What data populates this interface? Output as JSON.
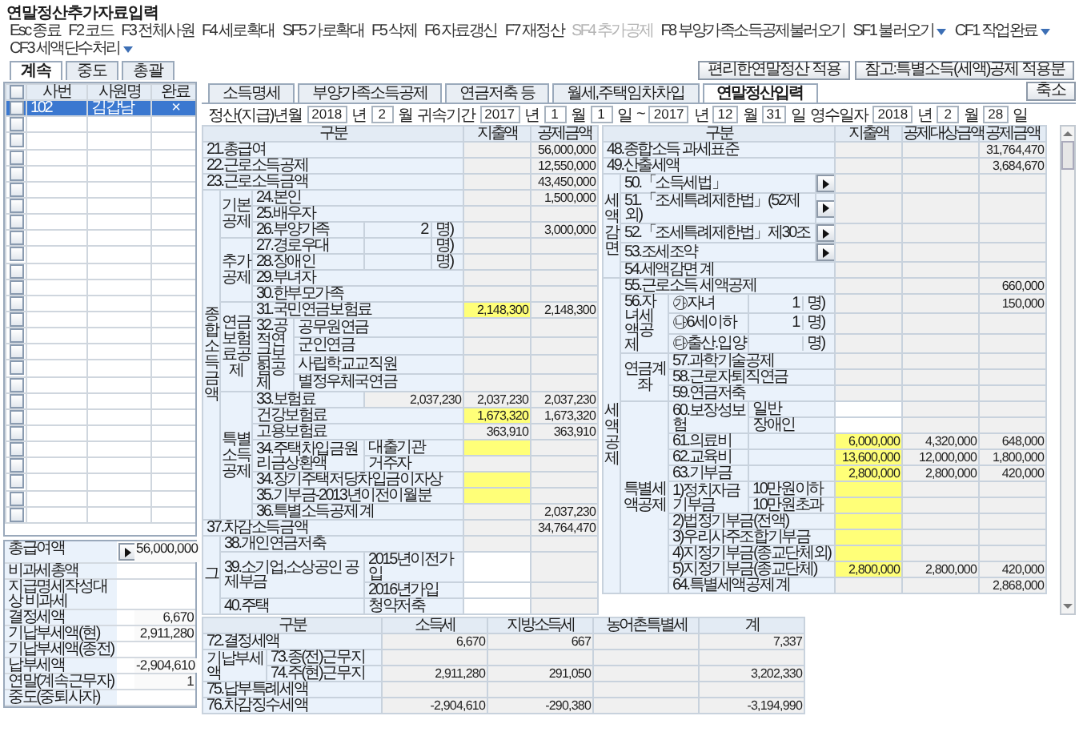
{
  "window": {
    "title": "연말정산추가자료입력"
  },
  "toolbar": [
    {
      "text": "Esc 종료",
      "disabled": false,
      "dropdown": false
    },
    {
      "text": "F2 코드",
      "disabled": false,
      "dropdown": false
    },
    {
      "text": "F3 전체사원",
      "disabled": false,
      "dropdown": false
    },
    {
      "text": "F4 세로확대",
      "disabled": false,
      "dropdown": false
    },
    {
      "text": "SF5 가로확대",
      "disabled": false,
      "dropdown": false
    },
    {
      "text": "F5 삭제",
      "disabled": false,
      "dropdown": false
    },
    {
      "text": "F6 자료갱신",
      "disabled": false,
      "dropdown": false
    },
    {
      "text": "F7 재정산",
      "disabled": false,
      "dropdown": false
    },
    {
      "text": "SF4 추가공제",
      "disabled": true,
      "dropdown": false
    },
    {
      "text": "F8 부양가족소득공제불러오기",
      "disabled": false,
      "dropdown": false
    },
    {
      "text": "SF1 불러오기",
      "disabled": false,
      "dropdown": true
    },
    {
      "text": "CF1 작업완료",
      "disabled": false,
      "dropdown": true
    },
    {
      "text": "CF3 세액단수처리",
      "disabled": false,
      "dropdown": true
    }
  ],
  "tabs": [
    {
      "label": "계속",
      "selected": true
    },
    {
      "label": "중도",
      "selected": false
    },
    {
      "label": "총괄",
      "selected": false
    }
  ],
  "actions": [
    "편리한연말정산 적용",
    "참고:특별소득(세액)공제 적용분"
  ],
  "employees": {
    "all_checked": false,
    "columns": [
      "사번",
      "사원명",
      "완료"
    ],
    "rows": [
      {
        "checked": false,
        "selected": true,
        "code": "102",
        "name": "김갑남",
        "done": "×"
      },
      {
        "checked": false,
        "selected": false
      },
      {
        "checked": false,
        "selected": false
      },
      {
        "checked": false,
        "selected": false
      },
      {
        "checked": false,
        "selected": false
      },
      {
        "checked": false,
        "selected": false
      },
      {
        "checked": false,
        "selected": false
      },
      {
        "checked": false,
        "selected": false
      },
      {
        "checked": false,
        "selected": false
      },
      {
        "checked": false,
        "selected": false
      },
      {
        "checked": false,
        "selected": false
      },
      {
        "checked": false,
        "selected": false
      },
      {
        "checked": false,
        "selected": false
      },
      {
        "checked": false,
        "selected": false
      },
      {
        "checked": false,
        "selected": false
      },
      {
        "checked": false,
        "selected": false
      },
      {
        "checked": false,
        "selected": false
      },
      {
        "checked": false,
        "selected": false
      },
      {
        "checked": false,
        "selected": false
      },
      {
        "checked": false,
        "selected": false
      },
      {
        "checked": false,
        "selected": false
      },
      {
        "checked": false,
        "selected": false
      },
      {
        "checked": false,
        "selected": false
      },
      {
        "checked": false,
        "selected": false
      },
      {
        "checked": false,
        "selected": false
      },
      {
        "checked": false,
        "selected": false
      }
    ]
  },
  "summary": [
    {
      "label": "총급여액",
      "kind": "arrow",
      "value": "56,000,000"
    },
    {
      "label": "비과세총액",
      "kind": "plain"
    },
    {
      "label": "지급명세작성대상 비과세",
      "kind": "plain"
    },
    {
      "label": "결정세액",
      "kind": "plain",
      "value": "6,670"
    },
    {
      "label": "기납부세액(현)",
      "kind": "plain",
      "value": "2,911,280"
    },
    {
      "label": "기납부세액(종전)",
      "kind": "plain"
    },
    {
      "label": "납부세액",
      "kind": "plain",
      "value": "-2,904,610"
    },
    {
      "label": "연말(계속근무자)",
      "kind": "plain",
      "value": "1"
    },
    {
      "label": "중도(중퇴사자)",
      "kind": "plain"
    }
  ],
  "main_tabs": [
    {
      "label": "소득명세",
      "selected": false
    },
    {
      "label": "부양가족소득공제",
      "selected": false
    },
    {
      "label": "연금저축 등",
      "selected": false
    },
    {
      "label": "월세,주택임차차입",
      "selected": false
    },
    {
      "label": "연말정산입력",
      "selected": true
    }
  ],
  "collapse_button": "축소",
  "period": [
    {
      "kind": "label",
      "text": "정산(지급)년월"
    },
    {
      "kind": "field",
      "text": "2018"
    },
    {
      "kind": "label",
      "text": "년"
    },
    {
      "kind": "field",
      "text": "2"
    },
    {
      "kind": "label",
      "text": "월"
    },
    {
      "kind": "label",
      "text": "귀속기간"
    },
    {
      "kind": "field",
      "text": "2017"
    },
    {
      "kind": "label",
      "text": "년"
    },
    {
      "kind": "field",
      "text": "1"
    },
    {
      "kind": "label",
      "text": "월"
    },
    {
      "kind": "field",
      "text": "1"
    },
    {
      "kind": "label",
      "text": "일"
    },
    {
      "kind": "label",
      "text": "~"
    },
    {
      "kind": "field",
      "text": "2017"
    },
    {
      "kind": "label",
      "text": "년"
    },
    {
      "kind": "field",
      "text": "12"
    },
    {
      "kind": "label",
      "text": "월"
    },
    {
      "kind": "field",
      "text": "31"
    },
    {
      "kind": "label",
      "text": "일"
    },
    {
      "kind": "label",
      "text": "영수일자"
    },
    {
      "kind": "field",
      "text": "2018"
    },
    {
      "kind": "label",
      "text": "년"
    },
    {
      "kind": "field",
      "text": "2"
    },
    {
      "kind": "label",
      "text": "월"
    },
    {
      "kind": "field",
      "text": "28"
    },
    {
      "kind": "label",
      "text": "일"
    }
  ],
  "income_table": {
    "rows": [
      [
        {
          "kind": "head",
          "text": "구분",
          "colspan": 5
        },
        {
          "kind": "head",
          "text": "지출액"
        },
        {
          "kind": "head",
          "text": "공제금액"
        }
      ],
      [
        {
          "kind": "label",
          "text": "21.총급여",
          "colspan": 5
        },
        {
          "kind": "num"
        },
        {
          "kind": "num",
          "text": "56,000,000"
        }
      ],
      [
        {
          "kind": "label",
          "text": "22.근로소득공제",
          "colspan": 5
        },
        {
          "kind": "num"
        },
        {
          "kind": "num",
          "text": "12,550,000"
        }
      ],
      [
        {
          "kind": "label",
          "text": "23.근로소득금액",
          "colspan": 5
        },
        {
          "kind": "num"
        },
        {
          "kind": "num",
          "text": "43,450,000"
        }
      ],
      [
        {
          "kind": "vert",
          "text": "종합소득금액",
          "rowspan": 20
        },
        {
          "kind": "vert",
          "text": "기본공제",
          "rowspan": 3
        },
        {
          "kind": "label",
          "text": "24.본인",
          "colspan": 3
        },
        {
          "kind": "num"
        },
        {
          "kind": "num",
          "text": "1,500,000"
        }
      ],
      [
        {
          "kind": "label",
          "text": "25.배우자",
          "colspan": 3
        },
        {
          "kind": "num"
        },
        {
          "kind": "num"
        }
      ],
      [
        {
          "kind": "label",
          "text": "26.부양가족",
          "colspan": 2
        },
        {
          "kind": "count",
          "count": "2",
          "unit": "명)"
        },
        {
          "kind": "num"
        },
        {
          "kind": "num",
          "text": "3,000,000"
        }
      ],
      [
        {
          "kind": "vert",
          "text": "추가공제",
          "rowspan": 4
        },
        {
          "kind": "label",
          "text": "27.경로우대",
          "colspan": 2
        },
        {
          "kind": "count",
          "unit": "명)"
        },
        {
          "kind": "num"
        },
        {
          "kind": "num"
        }
      ],
      [
        {
          "kind": "label",
          "text": "28.장애인",
          "colspan": 2
        },
        {
          "kind": "count",
          "unit": "명)"
        },
        {
          "kind": "num"
        },
        {
          "kind": "num"
        }
      ],
      [
        {
          "kind": "label",
          "text": "29.부녀자",
          "colspan": 3
        },
        {
          "kind": "num"
        },
        {
          "kind": "num"
        }
      ],
      [
        {
          "kind": "label",
          "text": "30.한부모가족",
          "colspan": 3
        },
        {
          "kind": "num"
        },
        {
          "kind": "num"
        }
      ],
      [
        {
          "kind": "vert",
          "text": "연금보험료공제",
          "rowspan": 5
        },
        {
          "kind": "label",
          "text": "31.국민연금보험료",
          "colspan": 3
        },
        {
          "kind": "input",
          "text": "2,148,300"
        },
        {
          "kind": "num",
          "text": "2,148,300"
        }
      ],
      [
        {
          "kind": "label",
          "text": "32.공적연금보험공제",
          "rowspan": 4
        },
        {
          "kind": "label",
          "text": "공무원연금",
          "colspan": 2
        },
        {
          "kind": "num"
        },
        {
          "kind": "num"
        }
      ],
      [
        {
          "kind": "label",
          "text": "군인연금",
          "colspan": 2
        },
        {
          "kind": "num"
        },
        {
          "kind": "num"
        }
      ],
      [
        {
          "kind": "label",
          "text": "사립학교교직원",
          "colspan": 2
        },
        {
          "kind": "num"
        },
        {
          "kind": "num"
        }
      ],
      [
        {
          "kind": "label",
          "text": "별정우체국연금",
          "colspan": 2
        },
        {
          "kind": "num"
        },
        {
          "kind": "num"
        }
      ],
      [
        {
          "kind": "vert",
          "text": "특별소득공제",
          "rowspan": 8
        },
        {
          "kind": "label",
          "text": "33.보험료",
          "colspan": 2
        },
        {
          "kind": "num",
          "text": "2,037,230"
        },
        {
          "kind": "num",
          "text": "2,037,230"
        },
        {
          "kind": "num",
          "text": "2,037,230"
        }
      ],
      [
        {
          "kind": "label",
          "text": "건강보험료",
          "colspan": 3
        },
        {
          "kind": "input",
          "text": "1,673,320"
        },
        {
          "kind": "num",
          "text": "1,673,320"
        }
      ],
      [
        {
          "kind": "label",
          "text": "고용보험료",
          "colspan": 3
        },
        {
          "kind": "num",
          "text": "363,910"
        },
        {
          "kind": "num",
          "text": "363,910"
        }
      ],
      [
        {
          "kind": "label",
          "text": "34.주택차입금원리금상환액",
          "colspan": 2,
          "rowspan": 2
        },
        {
          "kind": "label",
          "text": "대출기관"
        },
        {
          "kind": "input"
        },
        {
          "kind": "num"
        }
      ],
      [
        {
          "kind": "label",
          "text": "거주자"
        },
        {
          "kind": "num"
        },
        {
          "kind": "num"
        }
      ],
      [
        {
          "kind": "label",
          "text": "34.장기주택저당차입금이자상",
          "colspan": 3
        },
        {
          "kind": "input"
        },
        {
          "kind": "num"
        }
      ],
      [
        {
          "kind": "label",
          "text": "35.기부금-2013년이전이월분",
          "colspan": 3
        },
        {
          "kind": "input"
        },
        {
          "kind": "num"
        }
      ],
      [
        {
          "kind": "label",
          "text": "36.특별소득공제 계",
          "colspan": 3
        },
        {
          "kind": "num"
        },
        {
          "kind": "num",
          "text": "2,037,230"
        }
      ],
      [
        {
          "kind": "label",
          "text": "37.차감소득금액",
          "colspan": 5
        },
        {
          "kind": "num"
        },
        {
          "kind": "num",
          "text": "34,764,470"
        }
      ],
      [
        {
          "kind": "vert",
          "text": "그",
          "rowspan": 4
        },
        {
          "kind": "label",
          "text": "38.개인연금저축",
          "colspan": 4
        },
        {
          "kind": "num"
        },
        {
          "kind": "num"
        }
      ],
      [
        {
          "kind": "label",
          "text": "39.소기업,소상공인 공제부금",
          "colspan": 3,
          "rowspan": 2
        },
        {
          "kind": "label",
          "text": "2015년이전가입"
        },
        {
          "kind": "field"
        },
        {
          "kind": "num"
        }
      ],
      [
        {
          "kind": "label",
          "text": "2016년가입"
        },
        {
          "kind": "field"
        },
        {
          "kind": "num"
        }
      ],
      [
        {
          "kind": "label",
          "text": "40.주택",
          "colspan": 3
        },
        {
          "kind": "label",
          "text": "청약저축"
        },
        {
          "kind": "field"
        },
        {
          "kind": "num"
        }
      ]
    ]
  },
  "tax_table": {
    "rows": [
      [
        {
          "kind": "head",
          "text": "구분",
          "colspan": 5
        },
        {
          "kind": "head",
          "text": "지출액"
        },
        {
          "kind": "head",
          "text": "공제대상금액"
        },
        {
          "kind": "head",
          "text": "공제금액"
        }
      ],
      [
        {
          "kind": "label",
          "text": "48.종합소득 과세표준",
          "colspan": 5
        },
        {
          "kind": "num"
        },
        {
          "kind": "num"
        },
        {
          "kind": "num",
          "text": "31,764,470"
        }
      ],
      [
        {
          "kind": "label",
          "text": "49.산출세액",
          "colspan": 5
        },
        {
          "kind": "num"
        },
        {
          "kind": "num"
        },
        {
          "kind": "num",
          "text": "3,684,670"
        }
      ],
      [
        {
          "kind": "vert",
          "text": "세액감면",
          "rowspan": 5
        },
        {
          "kind": "label",
          "text": "50.「소득세법」",
          "colspan": 3
        },
        {
          "kind": "arrow"
        },
        {
          "kind": "num"
        },
        {
          "kind": "num"
        },
        {
          "kind": "num"
        }
      ],
      [
        {
          "kind": "label",
          "text": "51.「조세특례제한법」(52제외)",
          "colspan": 3
        },
        {
          "kind": "arrow"
        },
        {
          "kind": "num"
        },
        {
          "kind": "num"
        },
        {
          "kind": "num"
        }
      ],
      [
        {
          "kind": "label",
          "text": "52.「조세특례제한법」제30조",
          "colspan": 3
        },
        {
          "kind": "arrow"
        },
        {
          "kind": "num"
        },
        {
          "kind": "num"
        },
        {
          "kind": "num"
        }
      ],
      [
        {
          "kind": "label",
          "text": "53.조세조약",
          "colspan": 3
        },
        {
          "kind": "arrow"
        },
        {
          "kind": "num"
        },
        {
          "kind": "num"
        },
        {
          "kind": "num"
        }
      ],
      [
        {
          "kind": "label",
          "text": "54.세액감면 계",
          "colspan": 4
        },
        {
          "kind": "num"
        },
        {
          "kind": "num"
        },
        {
          "kind": "num"
        }
      ],
      [
        {
          "kind": "vert",
          "text": "세액공제",
          "rowspan": 19
        },
        {
          "kind": "label",
          "text": "55.근로소득 세액공제",
          "colspan": 4
        },
        {
          "kind": "num"
        },
        {
          "kind": "num"
        },
        {
          "kind": "num",
          "text": "660,000"
        }
      ],
      [
        {
          "kind": "label",
          "text": "56.자녀세액공제",
          "rowspan": 3
        },
        {
          "kind": "label",
          "text": "㉮자녀"
        },
        {
          "kind": "count",
          "count": "1",
          "unit": "명)",
          "colspan": 2
        },
        {
          "kind": "num"
        },
        {
          "kind": "num"
        },
        {
          "kind": "num",
          "text": "150,000"
        }
      ],
      [
        {
          "kind": "label",
          "text": "㉯6세이하"
        },
        {
          "kind": "count",
          "count": "1",
          "unit": "명)",
          "colspan": 2
        },
        {
          "kind": "num"
        },
        {
          "kind": "num"
        },
        {
          "kind": "num"
        }
      ],
      [
        {
          "kind": "label",
          "text": "㉰출산.입양"
        },
        {
          "kind": "count",
          "unit": "명)",
          "colspan": 2
        },
        {
          "kind": "num"
        },
        {
          "kind": "num"
        },
        {
          "kind": "num"
        }
      ],
      [
        {
          "kind": "vert",
          "text": "연금계좌",
          "rowspan": 3
        },
        {
          "kind": "label",
          "text": "57.과학기술공제",
          "colspan": 3
        },
        {
          "kind": "num"
        },
        {
          "kind": "num"
        },
        {
          "kind": "num"
        }
      ],
      [
        {
          "kind": "label",
          "text": "58.근로자퇴직연금",
          "colspan": 3
        },
        {
          "kind": "num"
        },
        {
          "kind": "num"
        },
        {
          "kind": "num"
        }
      ],
      [
        {
          "kind": "label",
          "text": "59.연금저축",
          "colspan": 3
        },
        {
          "kind": "num"
        },
        {
          "kind": "num"
        },
        {
          "kind": "num"
        }
      ],
      [
        {
          "kind": "vert",
          "text": "특별세액공제",
          "rowspan": 12
        },
        {
          "kind": "label",
          "text": "60.보장성보험",
          "rowspan": 2
        },
        {
          "kind": "label",
          "text": "일반",
          "colspan": 2
        },
        {
          "kind": "field"
        },
        {
          "kind": "num"
        },
        {
          "kind": "num"
        }
      ],
      [
        {
          "kind": "label",
          "text": "장애인",
          "colspan": 2
        },
        {
          "kind": "field"
        },
        {
          "kind": "num"
        },
        {
          "kind": "num"
        }
      ],
      [
        {
          "kind": "label",
          "text": "61.의료비"
        },
        {
          "kind": "label",
          "colspan": 2
        },
        {
          "kind": "input",
          "text": "6,000,000"
        },
        {
          "kind": "num",
          "text": "4,320,000"
        },
        {
          "kind": "num",
          "text": "648,000"
        }
      ],
      [
        {
          "kind": "label",
          "text": "62.교육비"
        },
        {
          "kind": "label",
          "colspan": 2
        },
        {
          "kind": "input",
          "text": "13,600,000"
        },
        {
          "kind": "num",
          "text": "12,000,000"
        },
        {
          "kind": "num",
          "text": "1,800,000"
        }
      ],
      [
        {
          "kind": "label",
          "text": "63.기부금"
        },
        {
          "kind": "label",
          "colspan": 2
        },
        {
          "kind": "input",
          "text": "2,800,000"
        },
        {
          "kind": "num",
          "text": "2,800,000"
        },
        {
          "kind": "num",
          "text": "420,000"
        }
      ],
      [
        {
          "kind": "label",
          "text": "1)정치자금기부금",
          "rowspan": 2
        },
        {
          "kind": "label",
          "text": "10만원이하",
          "colspan": 2
        },
        {
          "kind": "input"
        },
        {
          "kind": "num"
        },
        {
          "kind": "num"
        }
      ],
      [
        {
          "kind": "label",
          "text": "10만원초과",
          "colspan": 2
        },
        {
          "kind": "input"
        },
        {
          "kind": "num"
        },
        {
          "kind": "num"
        }
      ],
      [
        {
          "kind": "label",
          "text": "2)법정기부금(전액)",
          "colspan": 3
        },
        {
          "kind": "input"
        },
        {
          "kind": "num"
        },
        {
          "kind": "num"
        }
      ],
      [
        {
          "kind": "label",
          "text": "3)우리사주조합기부금",
          "colspan": 3
        },
        {
          "kind": "input"
        },
        {
          "kind": "num"
        },
        {
          "kind": "num"
        }
      ],
      [
        {
          "kind": "label",
          "text": "4)지정기부금(종교단체외)",
          "colspan": 3
        },
        {
          "kind": "input"
        },
        {
          "kind": "num"
        },
        {
          "kind": "num"
        }
      ],
      [
        {
          "kind": "label",
          "text": "5)지정기부금(종교단체)",
          "colspan": 3
        },
        {
          "kind": "input",
          "text": "2,800,000"
        },
        {
          "kind": "num",
          "text": "2,800,000"
        },
        {
          "kind": "num",
          "text": "420,000"
        }
      ],
      [
        {
          "kind": "label",
          "text": "64.특별세액공제 계",
          "colspan": 3
        },
        {
          "kind": "num"
        },
        {
          "kind": "num"
        },
        {
          "kind": "num",
          "text": "2,868,000"
        }
      ]
    ]
  },
  "result_table": {
    "rows": [
      [
        {
          "kind": "head",
          "text": "구분",
          "colspan": 2
        },
        {
          "kind": "head",
          "text": "소득세"
        },
        {
          "kind": "head",
          "text": "지방소득세"
        },
        {
          "kind": "head",
          "text": "농어촌특별세"
        },
        {
          "kind": "head",
          "text": "계"
        }
      ],
      [
        {
          "kind": "label",
          "text": "72.결정세액",
          "colspan": 2
        },
        {
          "kind": "num",
          "text": "6,670"
        },
        {
          "kind": "num",
          "text": "667"
        },
        {
          "kind": "num"
        },
        {
          "kind": "num",
          "text": "7,337"
        }
      ],
      [
        {
          "kind": "label",
          "text": "기납부세액",
          "rowspan": 2
        },
        {
          "kind": "label",
          "text": "73.종(전)근무지"
        },
        {
          "kind": "num"
        },
        {
          "kind": "num"
        },
        {
          "kind": "num"
        },
        {
          "kind": "num"
        }
      ],
      [
        {
          "kind": "label",
          "text": "74.주(현)근무지"
        },
        {
          "kind": "num",
          "text": "2,911,280"
        },
        {
          "kind": "num",
          "text": "291,050"
        },
        {
          "kind": "num"
        },
        {
          "kind": "num",
          "text": "3,202,330"
        }
      ],
      [
        {
          "kind": "label",
          "text": "75.납부특례세액",
          "colspan": 2
        },
        {
          "kind": "num"
        },
        {
          "kind": "num"
        },
        {
          "kind": "num"
        },
        {
          "kind": "num"
        }
      ],
      [
        {
          "kind": "label",
          "text": "76.차감징수세액",
          "colspan": 2
        },
        {
          "kind": "num",
          "text": "-2,904,610"
        },
        {
          "kind": "num",
          "text": "-290,380"
        },
        {
          "kind": "num"
        },
        {
          "kind": "num",
          "text": "-3,194,990"
        }
      ]
    ]
  }
}
